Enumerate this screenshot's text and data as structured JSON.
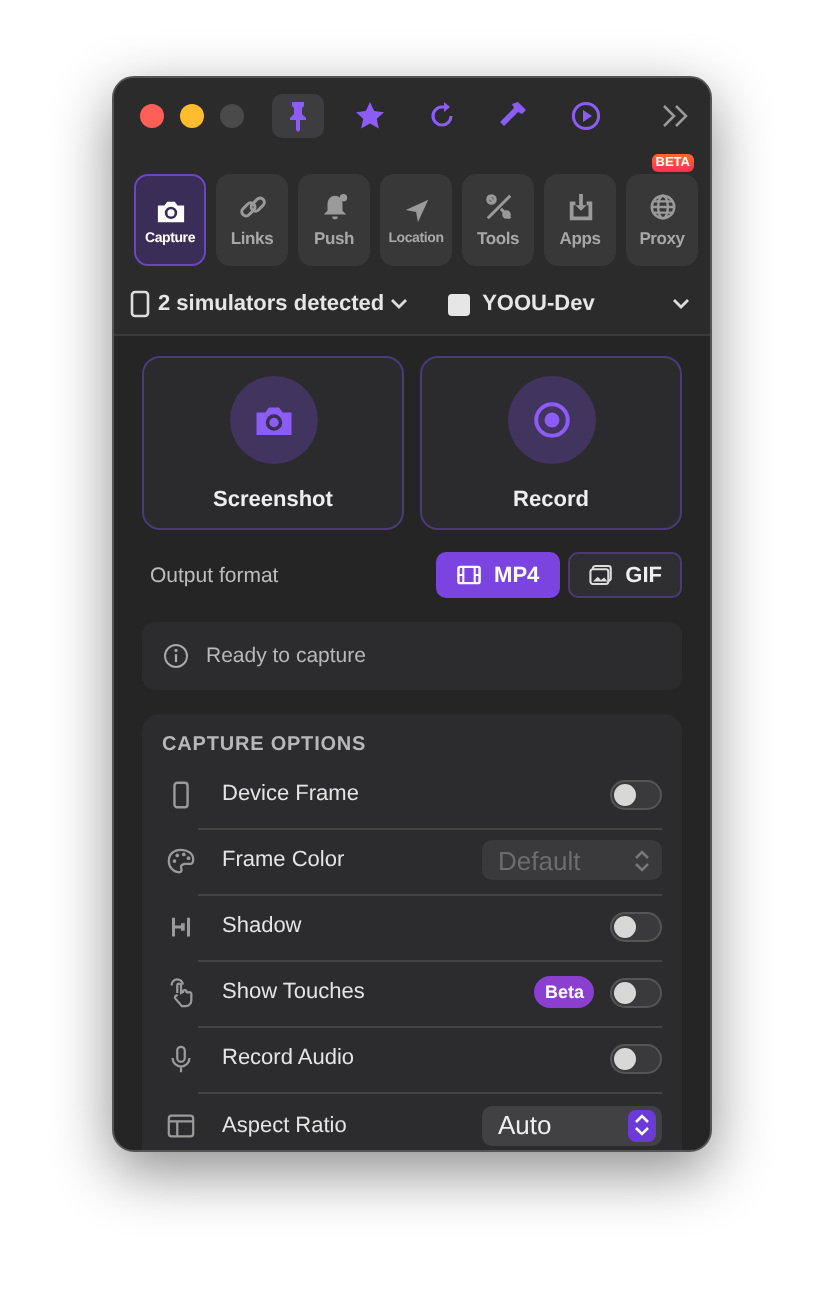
{
  "toolbar": [
    {
      "kind": "pin",
      "selected": true
    },
    {
      "kind": "star",
      "selected": false
    },
    {
      "kind": "refresh",
      "selected": false
    },
    {
      "kind": "hammer",
      "selected": false
    },
    {
      "kind": "play",
      "selected": false
    }
  ],
  "tabs": [
    {
      "kind": "camera",
      "label": "Capture",
      "selected": true
    },
    {
      "kind": "link",
      "label": "Links",
      "selected": false
    },
    {
      "kind": "bell",
      "label": "Push",
      "selected": false
    },
    {
      "kind": "location",
      "label": "Location",
      "selected": false
    },
    {
      "kind": "tools",
      "label": "Tools",
      "selected": false
    },
    {
      "kind": "apps",
      "label": "Apps",
      "selected": false
    },
    {
      "kind": "globe",
      "label": "Proxy",
      "selected": false,
      "badge": "BETA"
    }
  ],
  "simulators": {
    "label": "2 simulators detected",
    "device": "YOOU-Dev"
  },
  "actions": [
    {
      "kind": "camera",
      "label": "Screenshot"
    },
    {
      "kind": "record",
      "label": "Record"
    }
  ],
  "output_format": {
    "label": "Output format",
    "options": [
      {
        "kind": "film",
        "label": "MP4",
        "selected": true
      },
      {
        "kind": "photo",
        "label": "GIF",
        "selected": false
      }
    ]
  },
  "status": "Ready to capture",
  "capture_options": {
    "title": "CAPTURE OPTIONS",
    "rows": [
      {
        "kind": "toggle",
        "label": "Device Frame",
        "on": false
      },
      {
        "kind": "select",
        "label": "Frame Color",
        "value": "Default",
        "disabled": true
      },
      {
        "kind": "toggle",
        "label": "Shadow",
        "on": false
      },
      {
        "kind": "toggle",
        "label": "Show Touches",
        "on": false,
        "badge": "Beta"
      },
      {
        "kind": "toggle",
        "label": "Record Audio",
        "on": false
      },
      {
        "kind": "select",
        "label": "Aspect Ratio",
        "value": "Auto",
        "disabled": false
      }
    ]
  }
}
